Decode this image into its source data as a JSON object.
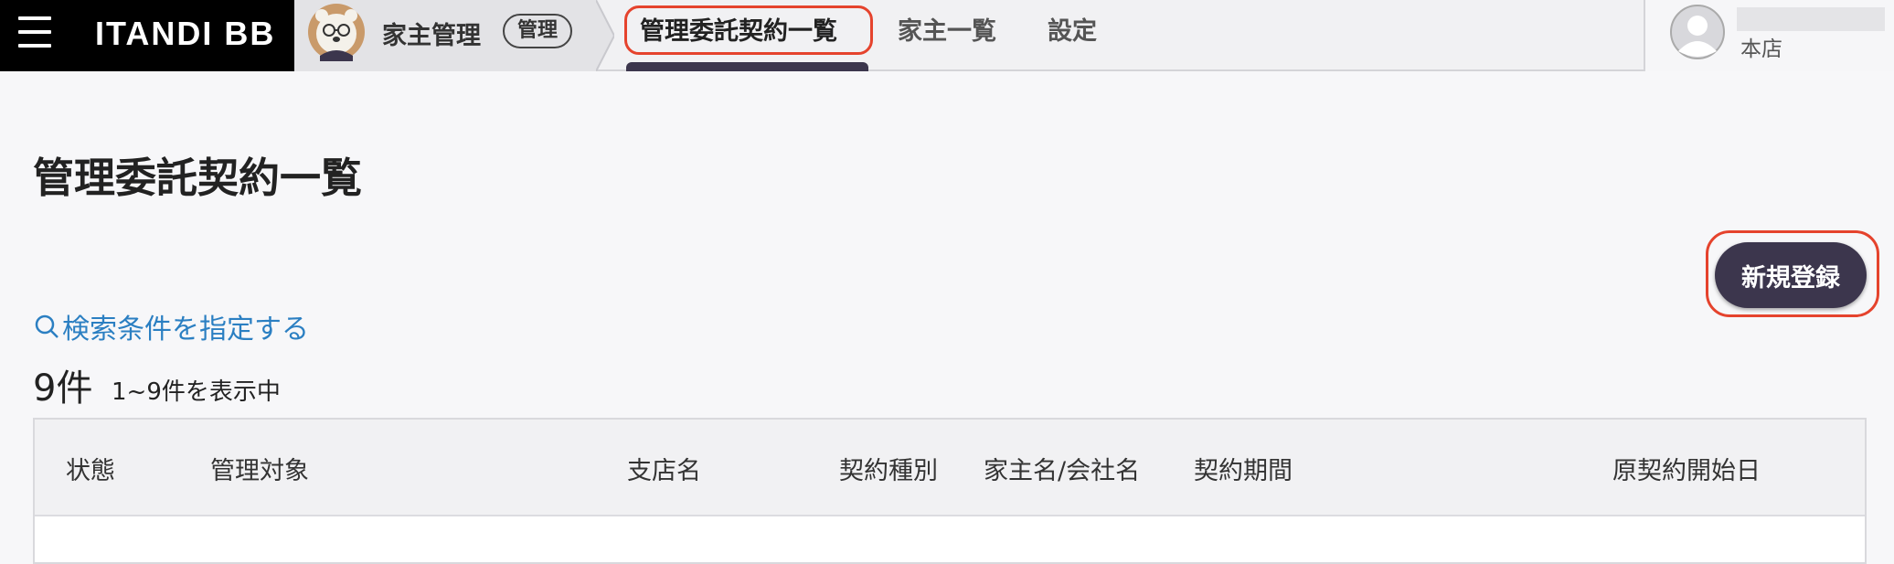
{
  "header": {
    "logo": "ITANDI BB",
    "app_name": "家主管理",
    "app_badge": "管理",
    "tabs": [
      {
        "label": "管理委託契約一覧",
        "active": true
      },
      {
        "label": "家主一覧",
        "active": false
      },
      {
        "label": "設定",
        "active": false
      }
    ],
    "user": {
      "branch": "本店"
    }
  },
  "main": {
    "title": "管理委託契約一覧",
    "new_button": "新規登録",
    "search_link": "検索条件を指定する",
    "count": "9件",
    "count_detail": "1~9件を表示中",
    "table": {
      "columns": [
        "状態",
        "管理対象",
        "支店名",
        "契約種別",
        "家主名/会社名",
        "契約期間",
        "原契約開始日"
      ]
    }
  },
  "colors": {
    "brand_dark": "#3c364d",
    "highlight_red": "#e5432d",
    "link_blue": "#2b7fc2",
    "header_black": "#000000"
  },
  "icons": [
    "hamburger-icon",
    "bear-avatar-icon",
    "user-avatar-icon",
    "search-icon"
  ]
}
